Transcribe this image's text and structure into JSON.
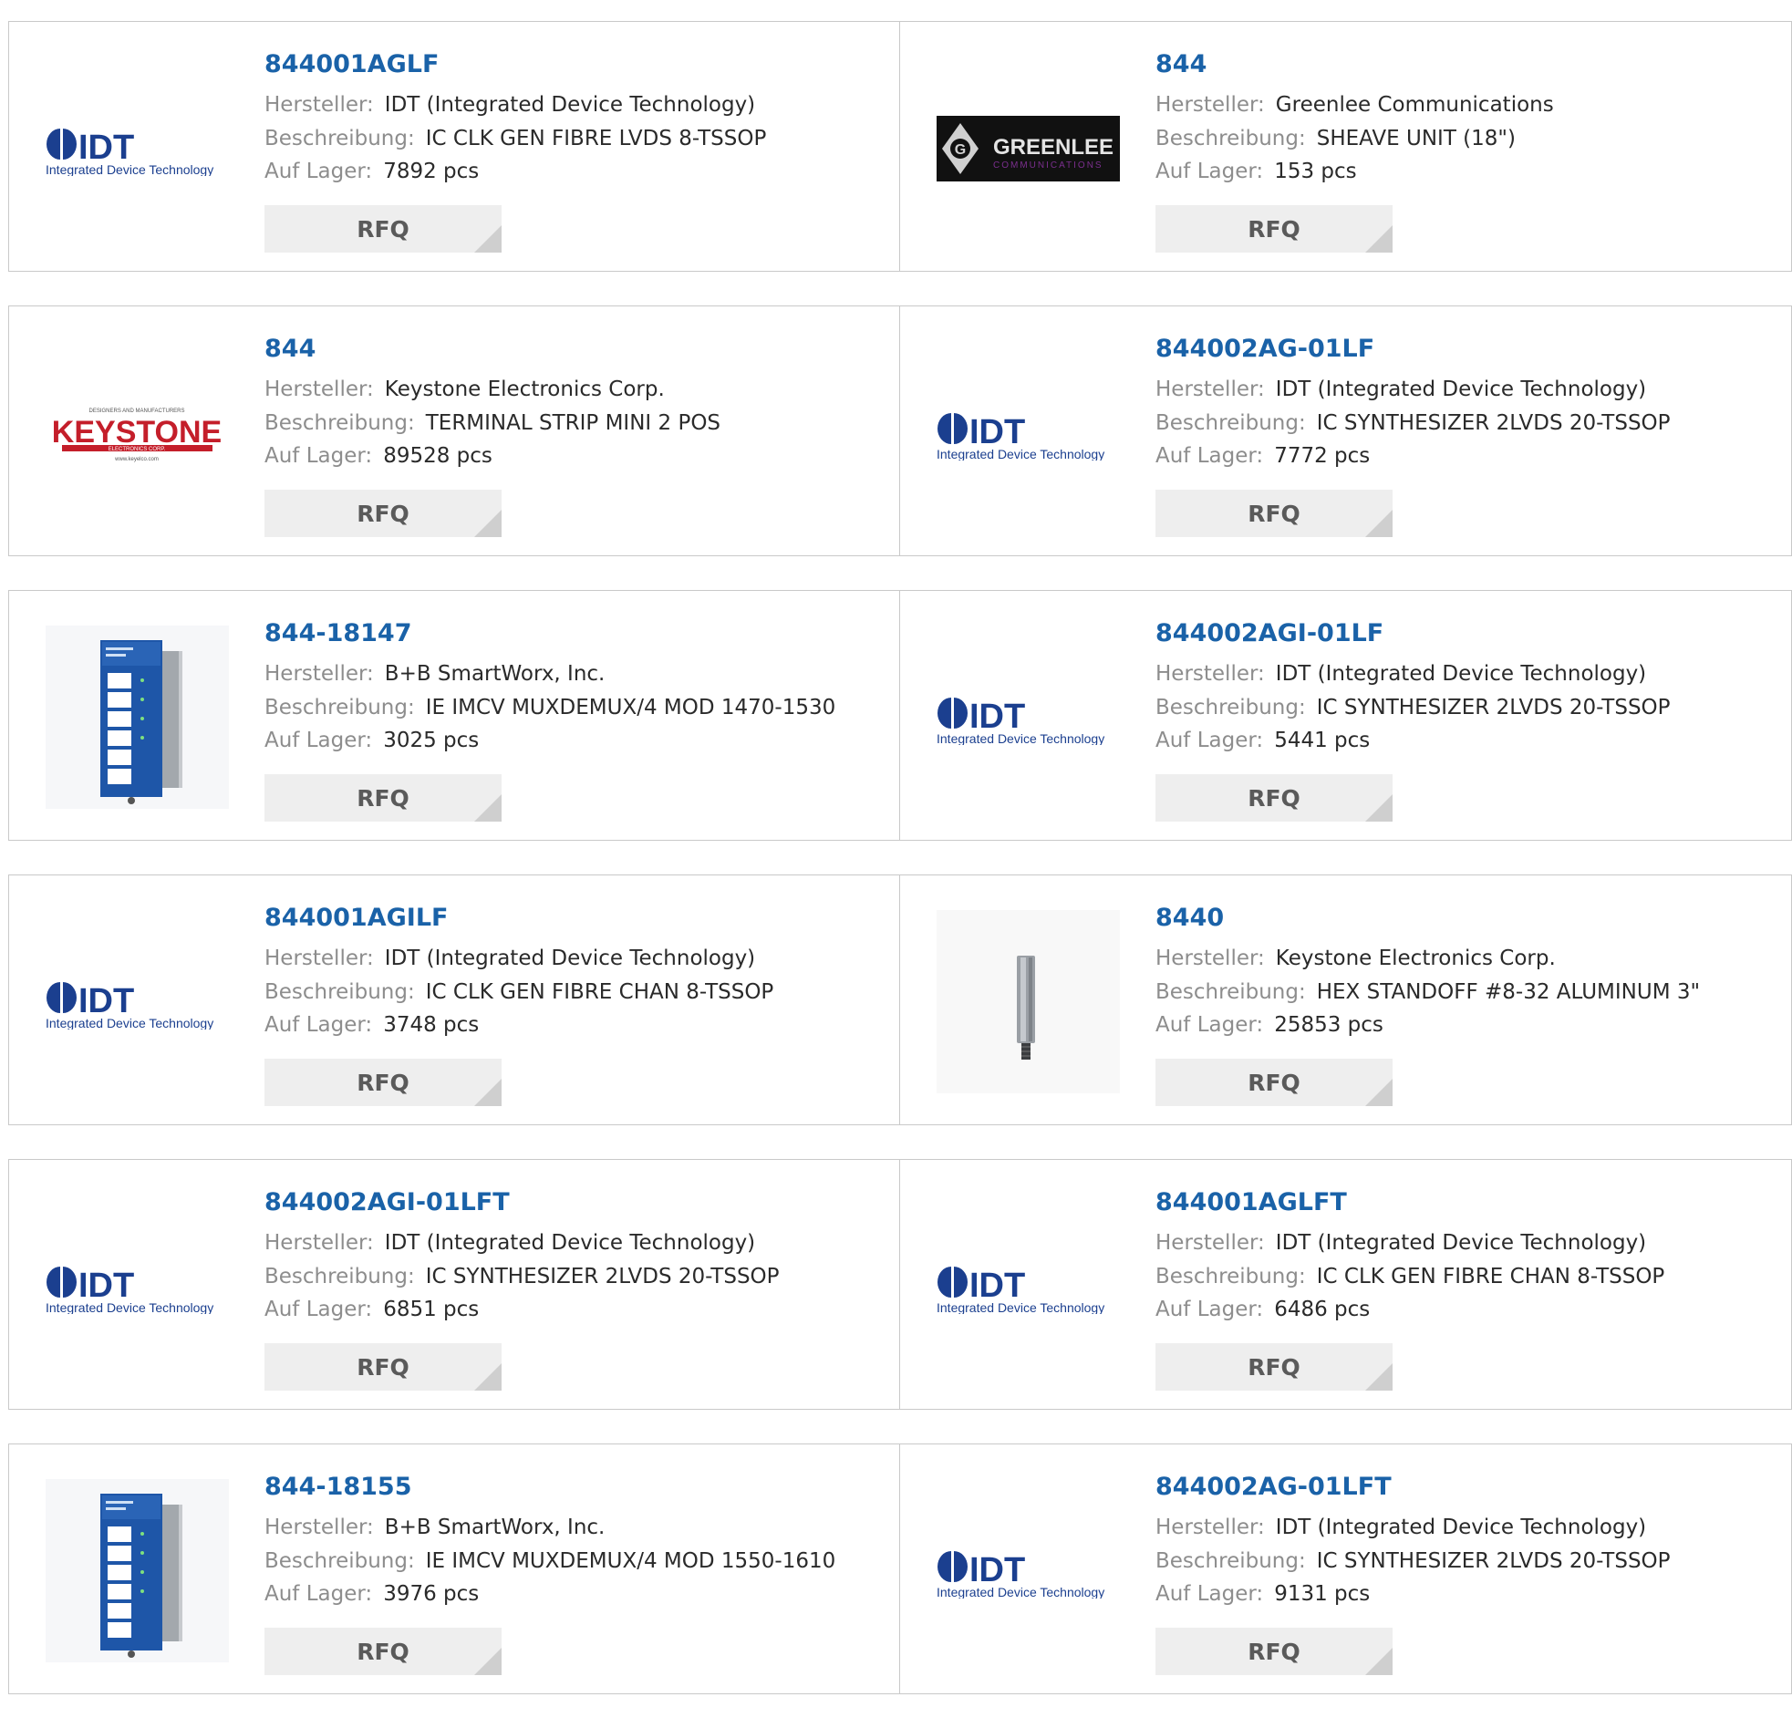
{
  "labels": {
    "manufacturer": "Hersteller:",
    "description": "Beschreibung:",
    "stock": "Auf Lager:",
    "rfq": "RFQ"
  },
  "logos": {
    "idt": {
      "mark": "IDT",
      "sub": "Integrated Device Technology"
    },
    "greenlee": {
      "mark": "GREENLEE",
      "sub": "COMMUNICATIONS"
    },
    "keystone": {
      "top": "DESIGNERS AND MANUFACTURERS",
      "mark": "KEYSTONE",
      "sub": "ELECTRONICS CORP.",
      "url": "www.keyelco.com"
    }
  },
  "products": [
    {
      "part": "844001AGLF",
      "manufacturer": "IDT (Integrated Device Technology)",
      "description": "IC CLK GEN FIBRE LVDS 8-TSSOP",
      "stock": "7892 pcs",
      "logo": "idt"
    },
    {
      "part": "844",
      "manufacturer": "Greenlee Communications",
      "description": "SHEAVE UNIT (18\")",
      "stock": "153 pcs",
      "logo": "greenlee"
    },
    {
      "part": "844",
      "manufacturer": "Keystone Electronics Corp.",
      "description": "TERMINAL STRIP MINI 2 POS",
      "stock": "89528 pcs",
      "logo": "keystone"
    },
    {
      "part": "844002AG-01LF",
      "manufacturer": "IDT (Integrated Device Technology)",
      "description": "IC SYNTHESIZER 2LVDS 20-TSSOP",
      "stock": "7772 pcs",
      "logo": "idt"
    },
    {
      "part": "844-18147",
      "manufacturer": "B+B SmartWorx, Inc.",
      "description": "IE IMCV MUXDEMUX/4 MOD 1470-1530",
      "stock": "3025 pcs",
      "logo": "module-photo"
    },
    {
      "part": "844002AGI-01LF",
      "manufacturer": "IDT (Integrated Device Technology)",
      "description": "IC SYNTHESIZER 2LVDS 20-TSSOP",
      "stock": "5441 pcs",
      "logo": "idt"
    },
    {
      "part": "844001AGILF",
      "manufacturer": "IDT (Integrated Device Technology)",
      "description": "IC CLK GEN FIBRE CHAN 8-TSSOP",
      "stock": "3748 pcs",
      "logo": "idt"
    },
    {
      "part": "8440",
      "manufacturer": "Keystone Electronics Corp.",
      "description": "HEX STANDOFF #8-32 ALUMINUM 3\"",
      "stock": "25853 pcs",
      "logo": "standoff-photo"
    },
    {
      "part": "844002AGI-01LFT",
      "manufacturer": "IDT (Integrated Device Technology)",
      "description": "IC SYNTHESIZER 2LVDS 20-TSSOP",
      "stock": "6851 pcs",
      "logo": "idt"
    },
    {
      "part": "844001AGLFT",
      "manufacturer": "IDT (Integrated Device Technology)",
      "description": "IC CLK GEN FIBRE CHAN 8-TSSOP",
      "stock": "6486 pcs",
      "logo": "idt"
    },
    {
      "part": "844-18155",
      "manufacturer": "B+B SmartWorx, Inc.",
      "description": "IE IMCV MUXDEMUX/4 MOD 1550-1610",
      "stock": "3976 pcs",
      "logo": "module-photo"
    },
    {
      "part": "844002AG-01LFT",
      "manufacturer": "IDT (Integrated Device Technology)",
      "description": "IC SYNTHESIZER 2LVDS 20-TSSOP",
      "stock": "9131 pcs",
      "logo": "idt"
    }
  ],
  "colors": {
    "part_link": "#1a62a8",
    "label": "#8d8d8d",
    "value": "#2a2a2a",
    "border": "#c9c9c9",
    "rfq_bg": "#eeeeee",
    "idt_blue": "#1b3f8f",
    "greenlee_purple": "#7b2f8e",
    "keystone_red": "#c41e2a",
    "module_blue": "#1e56a8"
  }
}
